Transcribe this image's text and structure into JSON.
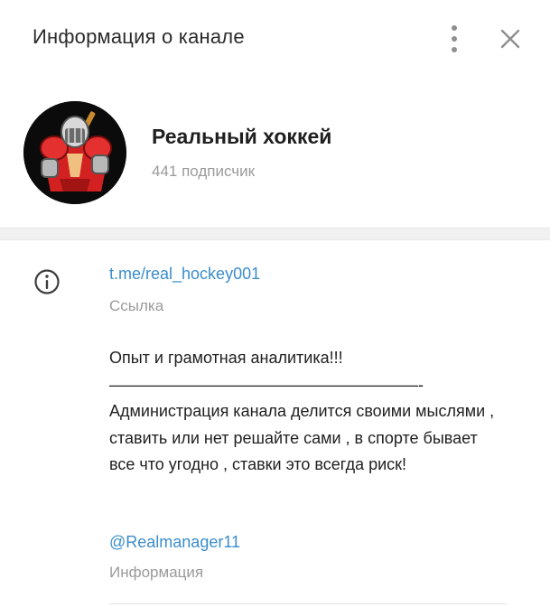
{
  "header": {
    "title": "Информация о канале",
    "menu_icon": "more-vertical-icon",
    "close_icon": "close-icon"
  },
  "profile": {
    "name": "Реальный хоккей",
    "subscribers": "441 подписчик",
    "avatar_icon": "hockey-player-avatar"
  },
  "info": {
    "icon": "info-icon",
    "link": "t.me/real_hockey001",
    "link_label": "Ссылка",
    "description": "Опыт и грамотная аналитика!!!\n———————————————————-\nАдминистрация канала делится своими мыслями , ставить или нет решайте сами , в спорте бывает все что угодно , ставки это всегда риск!",
    "username": "@Realmanager11",
    "username_label": "Информация"
  },
  "colors": {
    "link": "#3a8dcc",
    "muted": "#9a9a9a",
    "separator": "#f1f1f1"
  }
}
